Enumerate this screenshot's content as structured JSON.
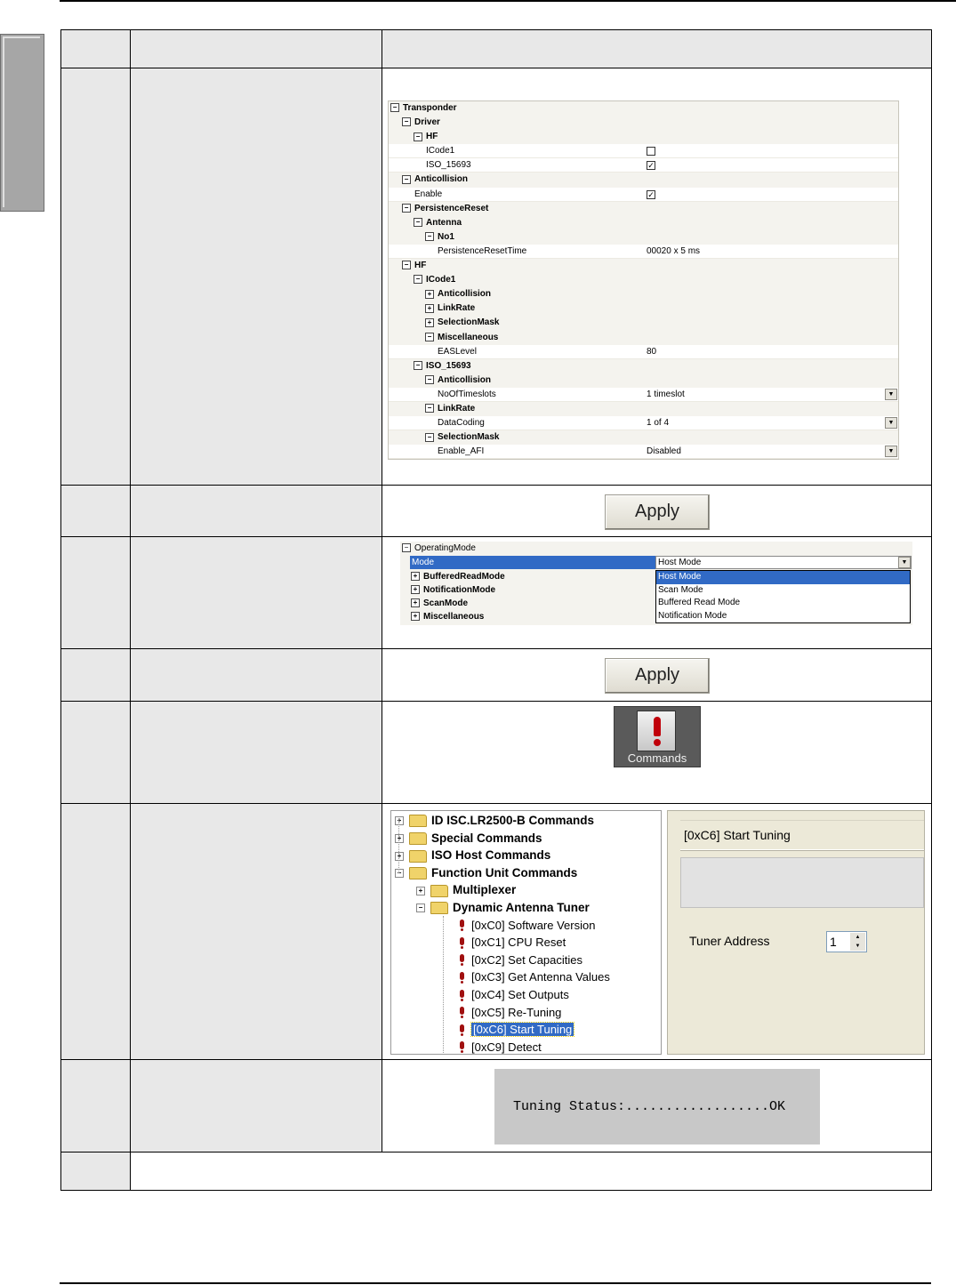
{
  "grid1": {
    "rows": [
      {
        "name": "Transponder",
        "type": "cat",
        "indent": 0
      },
      {
        "name": "Driver",
        "type": "cat",
        "indent": 1
      },
      {
        "name": "HF",
        "type": "cat",
        "indent": 2
      },
      {
        "name": "ICode1",
        "type": "check",
        "indent": 3,
        "checked": false
      },
      {
        "name": "ISO_15693",
        "type": "check",
        "indent": 3,
        "checked": true
      },
      {
        "name": "Anticollision",
        "type": "cat",
        "indent": 1
      },
      {
        "name": "Enable",
        "type": "check",
        "indent": 2,
        "checked": true
      },
      {
        "name": "PersistenceReset",
        "type": "cat",
        "indent": 1
      },
      {
        "name": "Antenna",
        "type": "cat",
        "indent": 2
      },
      {
        "name": "No1",
        "type": "cat",
        "indent": 3
      },
      {
        "name": "PersistenceResetTime",
        "type": "val",
        "indent": 4,
        "value": "00020 x 5 ms"
      },
      {
        "name": "HF",
        "type": "cat",
        "indent": 1
      },
      {
        "name": "ICode1",
        "type": "cat",
        "indent": 2
      },
      {
        "name": "Anticollision",
        "type": "cat",
        "indent": 3,
        "collapsed": true
      },
      {
        "name": "LinkRate",
        "type": "cat",
        "indent": 3,
        "collapsed": true
      },
      {
        "name": "SelectionMask",
        "type": "cat",
        "indent": 3,
        "collapsed": true
      },
      {
        "name": "Miscellaneous",
        "type": "cat",
        "indent": 3
      },
      {
        "name": "EASLevel",
        "type": "val",
        "indent": 4,
        "value": "80"
      },
      {
        "name": "ISO_15693",
        "type": "cat",
        "indent": 2
      },
      {
        "name": "Anticollision",
        "type": "cat",
        "indent": 3
      },
      {
        "name": "NoOfTimeslots",
        "type": "dd",
        "indent": 4,
        "value": "1 timeslot"
      },
      {
        "name": "LinkRate",
        "type": "cat",
        "indent": 3
      },
      {
        "name": "DataCoding",
        "type": "dd",
        "indent": 4,
        "value": "1 of 4"
      },
      {
        "name": "SelectionMask",
        "type": "cat",
        "indent": 3
      },
      {
        "name": "Enable_AFI",
        "type": "dd",
        "indent": 4,
        "value": "Disabled"
      }
    ]
  },
  "apply_label": "Apply",
  "operating_mode": {
    "category": "OperatingMode",
    "mode_label": "Mode",
    "mode_value": "Host Mode",
    "subcategories": [
      "BufferedReadMode",
      "NotificationMode",
      "ScanMode",
      "Miscellaneous"
    ],
    "options": [
      "Host Mode",
      "Scan Mode",
      "Buffered Read Mode",
      "Notification Mode"
    ]
  },
  "commands_label": "Commands",
  "tree": {
    "top": [
      "ID ISC.LR2500-B Commands",
      "Special Commands",
      "ISO Host Commands",
      "Function Unit Commands"
    ],
    "sub": [
      "Multiplexer",
      "Dynamic Antenna Tuner"
    ],
    "commands": [
      "[0xC0] Software Version",
      "[0xC1] CPU Reset",
      "[0xC2] Set Capacities",
      "[0xC3] Get Antenna Values",
      "[0xC4] Set Outputs",
      "[0xC5] Re-Tuning",
      "[0xC6] Start Tuning",
      "[0xC9] Detect"
    ]
  },
  "tuner": {
    "title": "[0xC6] Start Tuning",
    "address_label": "Tuner Address",
    "address_value": "1"
  },
  "status_text": "Tuning Status:..................OK"
}
